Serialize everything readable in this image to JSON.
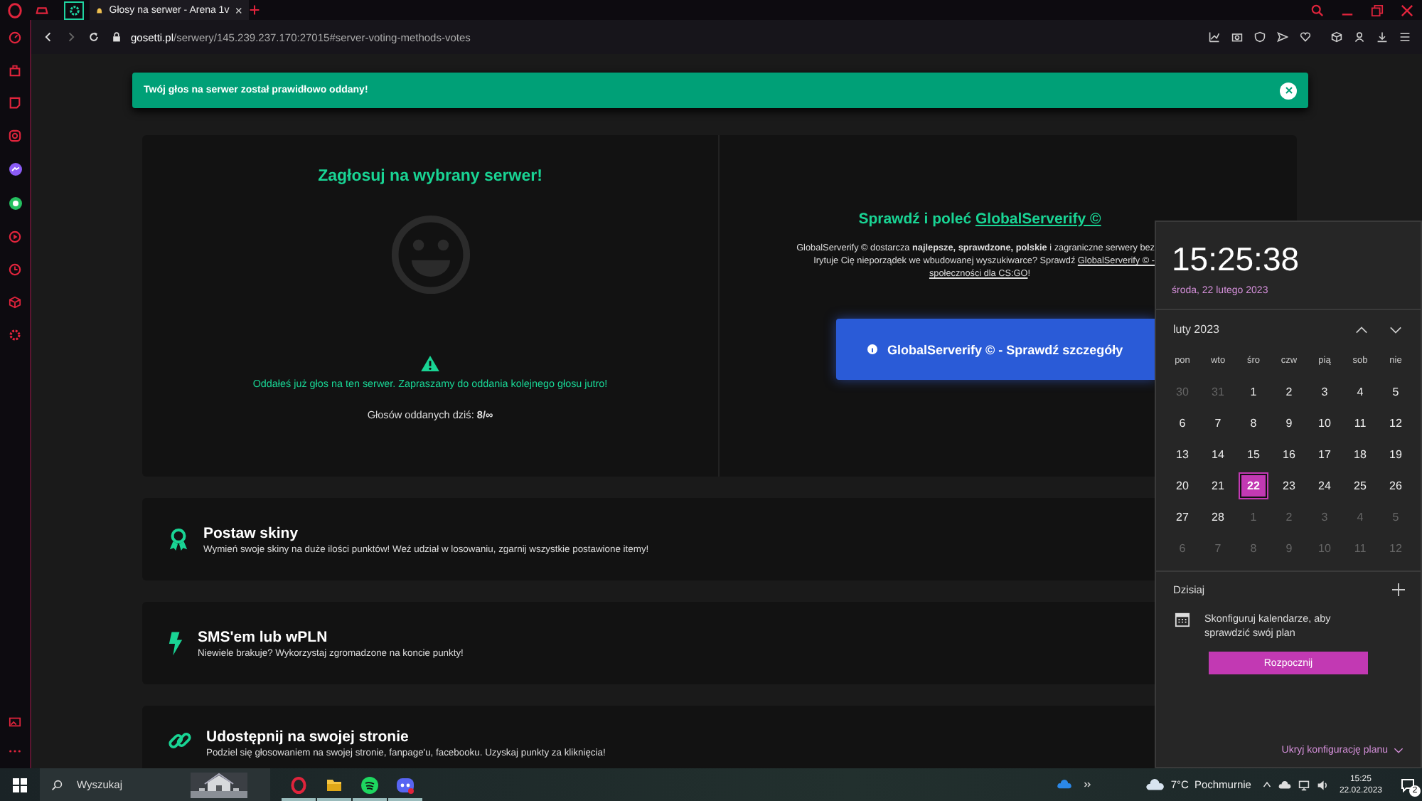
{
  "browser": {
    "tabs": [
      {
        "title": "Głosy na serwer - Arena 1v",
        "selected": true
      }
    ],
    "url": {
      "host": "gosetti.pl",
      "path": "/serwery/145.239.237.170:27015#server-voting-methods-votes"
    }
  },
  "toast": {
    "message": "Twój głos na serwer został prawidłowo oddany!"
  },
  "vote": {
    "title": "Zagłosuj na wybrany serwer!",
    "warning": "Oddałeś już głos na ten serwer. Zapraszamy do oddania kolejnego głosu jutro!",
    "count": "Głosów oddanych dziś: **8/∞**"
  },
  "promo": {
    "title": "Sprawdź i poleć",
    "title_link": "GlobalServerify ©",
    "line_1": "GlobalServerify © dostarcza **najlepsze, sprawdzone, polskie** i zagraniczne serwery bez",
    "line_2": "Irytuje Cię nieporządek we wbudowanej wyszukiwarce? Sprawdź",
    "line_2_link": "GlobalServerify © -",
    "line_3_link": "społeczności dla CS:GO",
    "line_3": "!",
    "button": "GlobalServerify © - Sprawdź szczegóły"
  },
  "features": [
    {
      "kind": "award",
      "title": "Postaw skiny",
      "description": "Wymień swoje skiny na duże ilości punktów! Weź udział w losowaniu, zgarnij wszystkie postawione itemy!"
    },
    {
      "kind": "bolt",
      "title": "SMS'em lub wPLN",
      "description": "Niewiele brakuje? Wykorzystaj zgromadzone na koncie punkty!"
    },
    {
      "kind": "link",
      "title": "Udostępnij na swojej stronie",
      "description": "Podziel się głosowaniem na swojej stronie, fanpage'u, facebooku. Uzyskaj punkty za kliknięcia!"
    }
  ],
  "calendar": {
    "time": "15:25:38",
    "date": "środa, 22 lutego 2023",
    "month": "luty 2023",
    "weekdays": [
      "pon",
      "wto",
      "śro",
      "czw",
      "pią",
      "sob",
      "nie"
    ],
    "weeks": [
      [
        {
          "label": "30",
          "muted": true,
          "selected": false
        },
        {
          "label": "31",
          "muted": true,
          "selected": false
        },
        {
          "label": "1",
          "muted": false,
          "selected": false
        },
        {
          "label": "2",
          "muted": false,
          "selected": false
        },
        {
          "label": "3",
          "muted": false,
          "selected": false
        },
        {
          "label": "4",
          "muted": false,
          "selected": false
        },
        {
          "label": "5",
          "muted": false,
          "selected": false
        }
      ],
      [
        {
          "label": "6",
          "muted": false,
          "selected": false
        },
        {
          "label": "7",
          "muted": false,
          "selected": false
        },
        {
          "label": "8",
          "muted": false,
          "selected": false
        },
        {
          "label": "9",
          "muted": false,
          "selected": false
        },
        {
          "label": "10",
          "muted": false,
          "selected": false
        },
        {
          "label": "11",
          "muted": false,
          "selected": false
        },
        {
          "label": "12",
          "muted": false,
          "selected": false
        }
      ],
      [
        {
          "label": "13",
          "muted": false,
          "selected": false
        },
        {
          "label": "14",
          "muted": false,
          "selected": false
        },
        {
          "label": "15",
          "muted": false,
          "selected": false
        },
        {
          "label": "16",
          "muted": false,
          "selected": false
        },
        {
          "label": "17",
          "muted": false,
          "selected": false
        },
        {
          "label": "18",
          "muted": false,
          "selected": false
        },
        {
          "label": "19",
          "muted": false,
          "selected": false
        }
      ],
      [
        {
          "label": "20",
          "muted": false,
          "selected": false
        },
        {
          "label": "21",
          "muted": false,
          "selected": false
        },
        {
          "label": "22",
          "muted": false,
          "selected": true
        },
        {
          "label": "23",
          "muted": false,
          "selected": false
        },
        {
          "label": "24",
          "muted": false,
          "selected": false
        },
        {
          "label": "25",
          "muted": false,
          "selected": false
        },
        {
          "label": "26",
          "muted": false,
          "selected": false
        }
      ],
      [
        {
          "label": "27",
          "muted": false,
          "selected": false
        },
        {
          "label": "28",
          "muted": false,
          "selected": false
        },
        {
          "label": "1",
          "muted": true,
          "selected": false
        },
        {
          "label": "2",
          "muted": true,
          "selected": false
        },
        {
          "label": "3",
          "muted": true,
          "selected": false
        },
        {
          "label": "4",
          "muted": true,
          "selected": false
        },
        {
          "label": "5",
          "muted": true,
          "selected": false
        }
      ],
      [
        {
          "label": "6",
          "muted": true,
          "selected": false
        },
        {
          "label": "7",
          "muted": true,
          "selected": false
        },
        {
          "label": "8",
          "muted": true,
          "selected": false
        },
        {
          "label": "9",
          "muted": true,
          "selected": false
        },
        {
          "label": "10",
          "muted": true,
          "selected": false
        },
        {
          "label": "11",
          "muted": true,
          "selected": false
        },
        {
          "label": "12",
          "muted": true,
          "selected": false
        }
      ]
    ],
    "today_label": "Dzisiaj",
    "agenda_text": "Skonfiguruj kalendarze, aby sprawdzić swój plan",
    "start_button": "Rozpocznij",
    "hide_link": "Ukryj konfigurację planu"
  },
  "taskbar": {
    "search_placeholder": "Wyszukaj",
    "apps": [
      {
        "kind": "opera",
        "running": true
      },
      {
        "kind": "folder",
        "running": true
      },
      {
        "kind": "spotify",
        "running": true
      },
      {
        "kind": "discord",
        "running": true
      }
    ],
    "temperature": "7°C",
    "weather": "Pochmurnie",
    "time": "15:25",
    "date": "22.02.2023",
    "notifications": "2"
  }
}
